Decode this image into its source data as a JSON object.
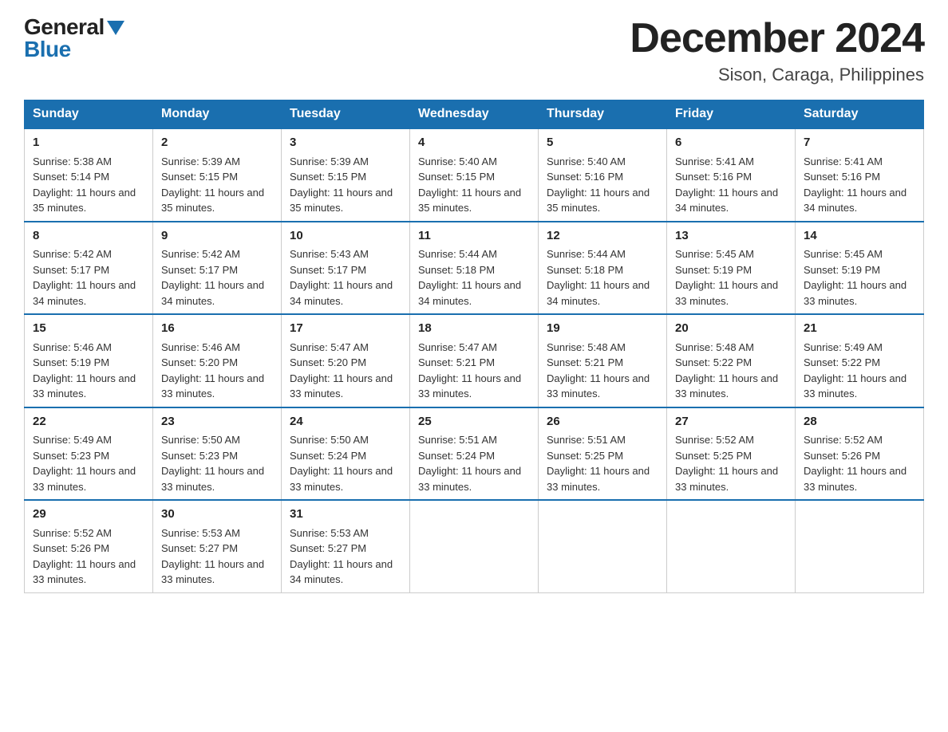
{
  "logo": {
    "general": "General",
    "blue": "Blue",
    "arrow": "▼"
  },
  "title": {
    "month": "December 2024",
    "location": "Sison, Caraga, Philippines"
  },
  "weekdays": [
    "Sunday",
    "Monday",
    "Tuesday",
    "Wednesday",
    "Thursday",
    "Friday",
    "Saturday"
  ],
  "weeks": [
    [
      {
        "day": "1",
        "sunrise": "5:38 AM",
        "sunset": "5:14 PM",
        "daylight": "11 hours and 35 minutes."
      },
      {
        "day": "2",
        "sunrise": "5:39 AM",
        "sunset": "5:15 PM",
        "daylight": "11 hours and 35 minutes."
      },
      {
        "day": "3",
        "sunrise": "5:39 AM",
        "sunset": "5:15 PM",
        "daylight": "11 hours and 35 minutes."
      },
      {
        "day": "4",
        "sunrise": "5:40 AM",
        "sunset": "5:15 PM",
        "daylight": "11 hours and 35 minutes."
      },
      {
        "day": "5",
        "sunrise": "5:40 AM",
        "sunset": "5:16 PM",
        "daylight": "11 hours and 35 minutes."
      },
      {
        "day": "6",
        "sunrise": "5:41 AM",
        "sunset": "5:16 PM",
        "daylight": "11 hours and 34 minutes."
      },
      {
        "day": "7",
        "sunrise": "5:41 AM",
        "sunset": "5:16 PM",
        "daylight": "11 hours and 34 minutes."
      }
    ],
    [
      {
        "day": "8",
        "sunrise": "5:42 AM",
        "sunset": "5:17 PM",
        "daylight": "11 hours and 34 minutes."
      },
      {
        "day": "9",
        "sunrise": "5:42 AM",
        "sunset": "5:17 PM",
        "daylight": "11 hours and 34 minutes."
      },
      {
        "day": "10",
        "sunrise": "5:43 AM",
        "sunset": "5:17 PM",
        "daylight": "11 hours and 34 minutes."
      },
      {
        "day": "11",
        "sunrise": "5:44 AM",
        "sunset": "5:18 PM",
        "daylight": "11 hours and 34 minutes."
      },
      {
        "day": "12",
        "sunrise": "5:44 AM",
        "sunset": "5:18 PM",
        "daylight": "11 hours and 34 minutes."
      },
      {
        "day": "13",
        "sunrise": "5:45 AM",
        "sunset": "5:19 PM",
        "daylight": "11 hours and 33 minutes."
      },
      {
        "day": "14",
        "sunrise": "5:45 AM",
        "sunset": "5:19 PM",
        "daylight": "11 hours and 33 minutes."
      }
    ],
    [
      {
        "day": "15",
        "sunrise": "5:46 AM",
        "sunset": "5:19 PM",
        "daylight": "11 hours and 33 minutes."
      },
      {
        "day": "16",
        "sunrise": "5:46 AM",
        "sunset": "5:20 PM",
        "daylight": "11 hours and 33 minutes."
      },
      {
        "day": "17",
        "sunrise": "5:47 AM",
        "sunset": "5:20 PM",
        "daylight": "11 hours and 33 minutes."
      },
      {
        "day": "18",
        "sunrise": "5:47 AM",
        "sunset": "5:21 PM",
        "daylight": "11 hours and 33 minutes."
      },
      {
        "day": "19",
        "sunrise": "5:48 AM",
        "sunset": "5:21 PM",
        "daylight": "11 hours and 33 minutes."
      },
      {
        "day": "20",
        "sunrise": "5:48 AM",
        "sunset": "5:22 PM",
        "daylight": "11 hours and 33 minutes."
      },
      {
        "day": "21",
        "sunrise": "5:49 AM",
        "sunset": "5:22 PM",
        "daylight": "11 hours and 33 minutes."
      }
    ],
    [
      {
        "day": "22",
        "sunrise": "5:49 AM",
        "sunset": "5:23 PM",
        "daylight": "11 hours and 33 minutes."
      },
      {
        "day": "23",
        "sunrise": "5:50 AM",
        "sunset": "5:23 PM",
        "daylight": "11 hours and 33 minutes."
      },
      {
        "day": "24",
        "sunrise": "5:50 AM",
        "sunset": "5:24 PM",
        "daylight": "11 hours and 33 minutes."
      },
      {
        "day": "25",
        "sunrise": "5:51 AM",
        "sunset": "5:24 PM",
        "daylight": "11 hours and 33 minutes."
      },
      {
        "day": "26",
        "sunrise": "5:51 AM",
        "sunset": "5:25 PM",
        "daylight": "11 hours and 33 minutes."
      },
      {
        "day": "27",
        "sunrise": "5:52 AM",
        "sunset": "5:25 PM",
        "daylight": "11 hours and 33 minutes."
      },
      {
        "day": "28",
        "sunrise": "5:52 AM",
        "sunset": "5:26 PM",
        "daylight": "11 hours and 33 minutes."
      }
    ],
    [
      {
        "day": "29",
        "sunrise": "5:52 AM",
        "sunset": "5:26 PM",
        "daylight": "11 hours and 33 minutes."
      },
      {
        "day": "30",
        "sunrise": "5:53 AM",
        "sunset": "5:27 PM",
        "daylight": "11 hours and 33 minutes."
      },
      {
        "day": "31",
        "sunrise": "5:53 AM",
        "sunset": "5:27 PM",
        "daylight": "11 hours and 34 minutes."
      },
      null,
      null,
      null,
      null
    ]
  ]
}
